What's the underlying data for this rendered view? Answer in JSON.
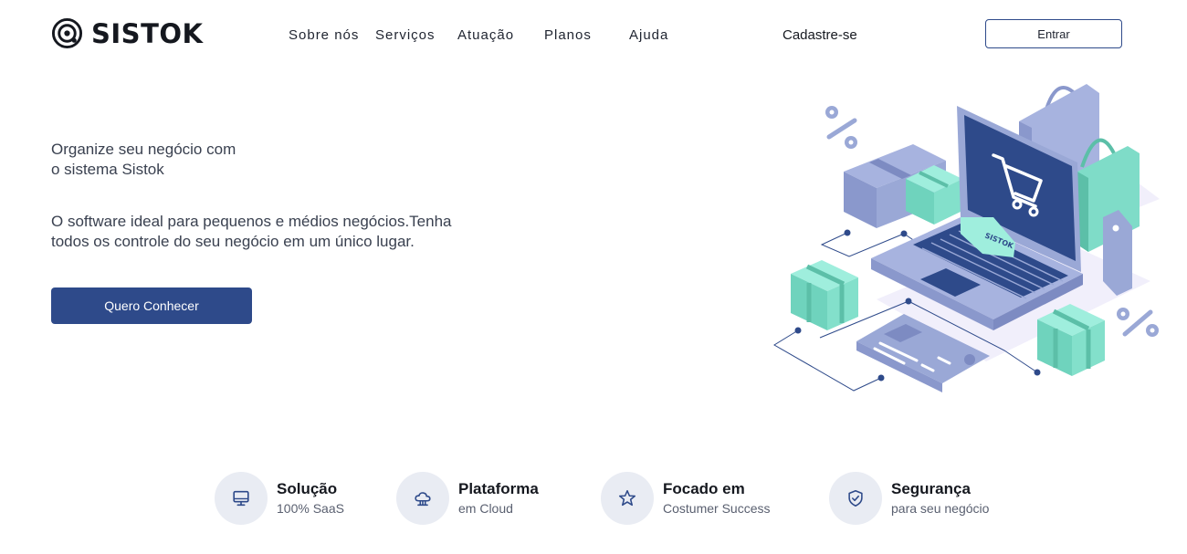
{
  "brand": {
    "name": "SISTOK",
    "logo_icon": "vinyl-disc-icon"
  },
  "nav": {
    "items": [
      "Sobre nós",
      "Serviços",
      "Atuação",
      "Planos",
      "Ajuda"
    ],
    "signup": "Cadastre-se",
    "login": "Entrar"
  },
  "hero": {
    "title_line1": "Organize seu negócio com",
    "title_line2": "o sistema Sistok",
    "sub_line1": "O software ideal para pequenos e médios negócios.Tenha",
    "sub_line2": "todos os controle do seu negócio em um único lugar.",
    "cta": "Quero Conhecer",
    "illustration_label": "SISTOK"
  },
  "features": [
    {
      "title": "Solução",
      "subtitle": "100% SaaS",
      "icon": "monitor-icon"
    },
    {
      "title": "Plataforma",
      "subtitle": "em Cloud",
      "icon": "cloud-icon"
    },
    {
      "title": "Focado em",
      "subtitle": "Costumer Success",
      "icon": "star-icon"
    },
    {
      "title": "Segurança",
      "subtitle": "para seu negócio",
      "icon": "shield-icon"
    }
  ],
  "colors": {
    "primary": "#2e4a8a",
    "lavender": "#9aa8d6",
    "mint": "#7fdcc8",
    "feature_bg": "#e9ecf3"
  }
}
